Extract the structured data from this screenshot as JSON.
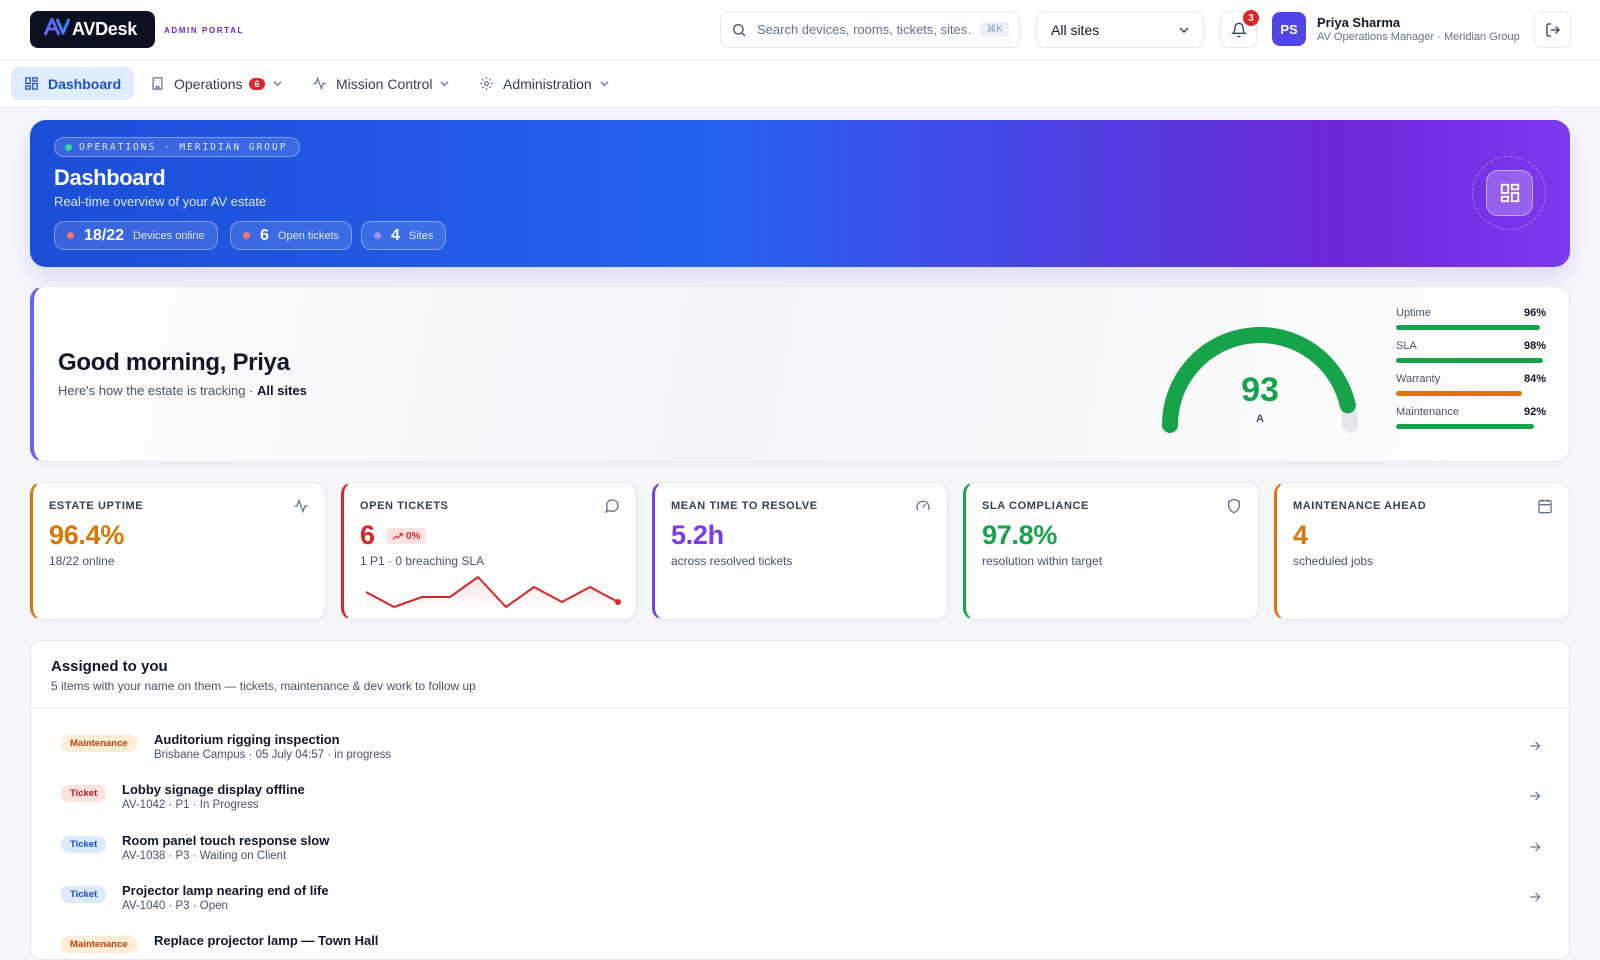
{
  "header": {
    "logo_text": "AVDesk",
    "portal_label": "ADMIN PORTAL",
    "search": {
      "placeholder": "Search devices, rooms, tickets, sites…",
      "shortcut": "⌘K"
    },
    "site_selector": {
      "selected": "All sites"
    },
    "notifications": {
      "count": "3"
    },
    "user": {
      "initials": "PS",
      "name": "Priya Sharma",
      "role": "AV Operations Manager · Meridian Group"
    }
  },
  "nav": {
    "items": [
      {
        "label": "Dashboard"
      },
      {
        "label": "Operations",
        "badge": "6"
      },
      {
        "label": "Mission Control"
      },
      {
        "label": "Administration"
      }
    ]
  },
  "hero": {
    "tag": "OPERATIONS · MERIDIAN GROUP",
    "title": "Dashboard",
    "subtitle": "Real-time overview of your AV estate",
    "chips": [
      {
        "value": "18/22",
        "label": "Devices online",
        "color": "#f87171"
      },
      {
        "value": "6",
        "label": "Open tickets",
        "color": "#f87171"
      },
      {
        "value": "4",
        "label": "Sites",
        "color": "#a78bfa"
      }
    ]
  },
  "greeting": {
    "title": "Good morning, Priya",
    "subtitle_prefix": "Here's how the estate is tracking · ",
    "subtitle_scope": "All sites",
    "score": {
      "value": "93",
      "grade": "A",
      "fraction": 0.93,
      "color": "#16a34a"
    },
    "metrics": [
      {
        "label": "Uptime",
        "value": "96%",
        "fraction": 0.96,
        "color": "#16a34a"
      },
      {
        "label": "SLA",
        "value": "98%",
        "fraction": 0.98,
        "color": "#16a34a"
      },
      {
        "label": "Warranty",
        "value": "84%",
        "fraction": 0.84,
        "color": "#d97706"
      },
      {
        "label": "Maintenance",
        "value": "92%",
        "fraction": 0.92,
        "color": "#16a34a"
      }
    ]
  },
  "kpis": [
    {
      "label": "ESTATE UPTIME",
      "value": "96.4%",
      "sub": "18/22 online",
      "color": "#d97706",
      "icon": "activity-icon"
    },
    {
      "label": "OPEN TICKETS",
      "value": "6",
      "trend": "0%",
      "sub": "1 P1 · 0 breaching SLA",
      "color": "#dc2626",
      "icon": "message-icon",
      "sparkline": [
        4,
        1,
        3,
        3,
        7,
        1,
        5,
        2,
        5,
        2
      ]
    },
    {
      "label": "MEAN TIME TO RESOLVE",
      "value": "5.2h",
      "sub": "across resolved tickets",
      "color": "#7c3aed",
      "icon": "gauge-icon"
    },
    {
      "label": "SLA COMPLIANCE",
      "value": "97.8%",
      "sub": "resolution within target",
      "color": "#16a34a",
      "icon": "shield-icon"
    },
    {
      "label": "MAINTENANCE AHEAD",
      "value": "4",
      "sub": "scheduled jobs",
      "color": "#d97706",
      "icon": "calendar-icon"
    }
  ],
  "assigned": {
    "title": "Assigned to you",
    "subtitle": "5 items with your name on them — tickets, maintenance & dev work to follow up",
    "items": [
      {
        "tag": "Maintenance",
        "title": "Auditorium rigging inspection",
        "meta": "Brisbane Campus · 05 July 04:57 · in progress"
      },
      {
        "tag": "Ticket",
        "title": "Lobby signage display offline",
        "meta": "AV-1042 · P1 · In Progress"
      },
      {
        "tag": "Ticket",
        "title": "Room panel touch response slow",
        "meta": "AV-1038 · P3 · Waiting on Client"
      },
      {
        "tag": "Ticket",
        "title": "Projector lamp nearing end of life",
        "meta": "AV-1040 · P3 · Open"
      },
      {
        "tag": "Maintenance",
        "title": "Replace projector lamp — Town Hall",
        "meta": ""
      }
    ]
  }
}
